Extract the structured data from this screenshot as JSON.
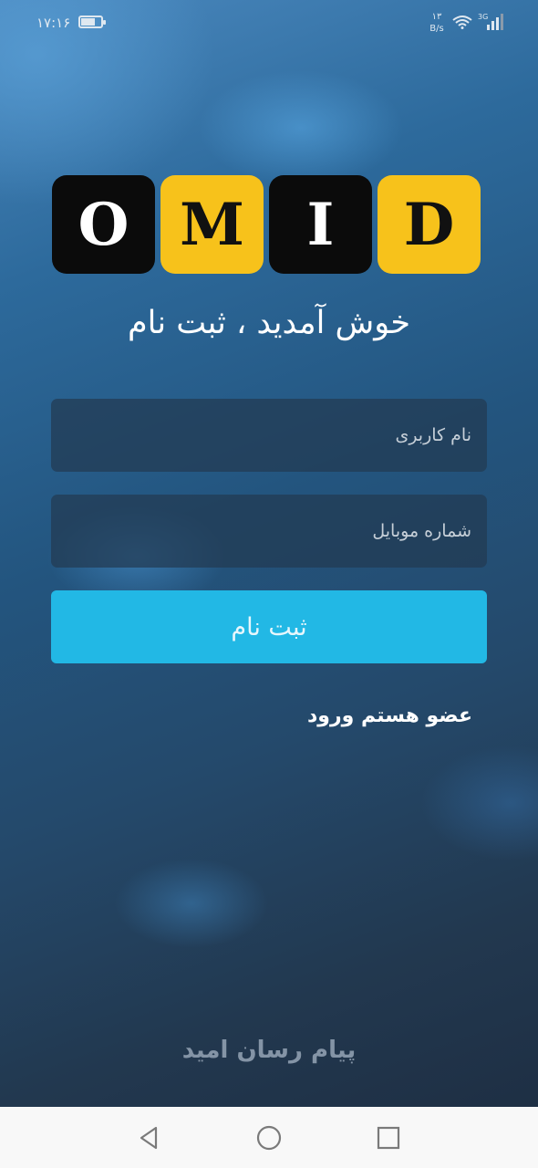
{
  "status_bar": {
    "time": "۱۷:۱۶",
    "net_speed_value": "۱۳",
    "net_speed_unit": "B/s",
    "network_type": "3G",
    "battery_icon": "battery-icon",
    "wifi_icon": "wifi-icon",
    "signal_icon": "signal-icon"
  },
  "logo": {
    "letters": [
      "O",
      "M",
      "I",
      "D"
    ],
    "colors": {
      "black_tile": "#0b0b0b",
      "yellow_tile": "#f7c21b"
    }
  },
  "welcome_title": "خوش آمدید ، ثبت نام",
  "form": {
    "username_placeholder": "نام کاربری",
    "mobile_placeholder": "شماره موبایل",
    "register_label": "ثبت نام",
    "login_link": "عضو هستم ورود"
  },
  "footer": "پیام رسان امید",
  "navigation": {
    "back_icon": "back-icon",
    "home_icon": "home-icon",
    "recents_icon": "recents-icon"
  },
  "colors": {
    "accent": "#22b8e5"
  }
}
